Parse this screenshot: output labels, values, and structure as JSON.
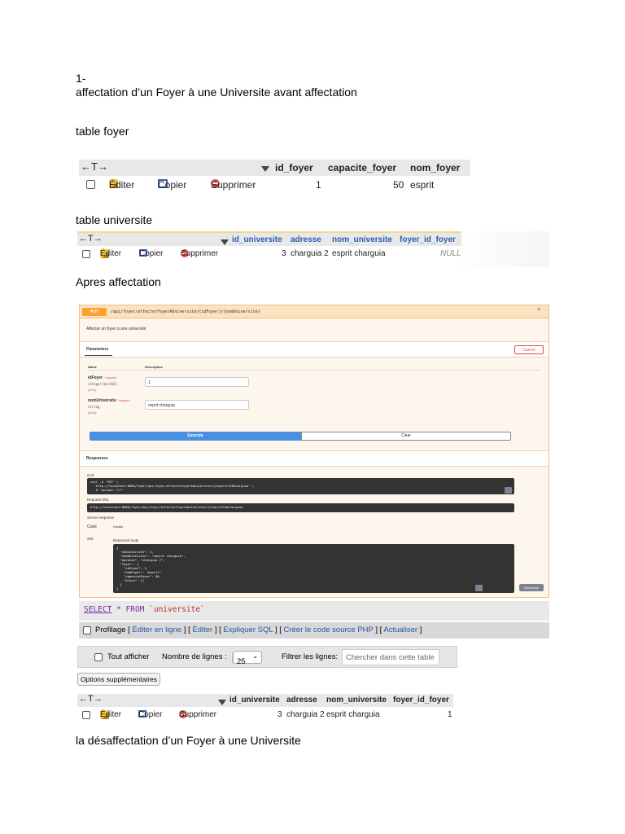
{
  "doc": {
    "step_number": "1-",
    "heading": "affectation d’un Foyer à une Universite avant affectation",
    "table_foyer_label": "table foyer",
    "table_universite_label": "table universite",
    "apres_label": "Apres affectation",
    "footer_heading": "la désaffectation d’un Foyer à une Universite"
  },
  "actions": {
    "arrows": "←T→",
    "edit": "Éditer",
    "copy": "Copier",
    "delete": "Supprimer"
  },
  "foyer_table": {
    "columns": [
      "id_foyer",
      "capacite_foyer",
      "nom_foyer"
    ],
    "row": {
      "id_foyer": "1",
      "capacite_foyer": "50",
      "nom_foyer": "esprit"
    }
  },
  "universite_table_before": {
    "columns": [
      "id_universite",
      "adresse",
      "nom_universite",
      "foyer_id_foyer"
    ],
    "row": {
      "id_universite": "3",
      "adresse": "charguia 2",
      "nom_universite": "esprit charguia",
      "foyer_id_foyer": "NULL"
    }
  },
  "swagger": {
    "method": "PUT",
    "path": "/api/foyer/affecterFoyerAUniversite/{idFoyer}/{nomUniversite}",
    "description": "Affecter un foyer à une université",
    "parameters_tab": "Parameters",
    "cancel": "Cancel",
    "col_name": "Name",
    "col_description": "Description",
    "required": "* required",
    "p1_name": "idFoyer",
    "p1_type": "integer($int64)",
    "p1_in": "(path)",
    "p1_value": "1",
    "p2_name": "nomUniversite",
    "p2_type": "string",
    "p2_in": "(path)",
    "p2_value": "esprit charguia",
    "execute": "Execute",
    "clear": "Clear",
    "responses": "Responses",
    "curl_label": "Curl",
    "curl": "curl -X 'PUT' \\\n  'http://localhost:8080/foyer/api/foyer/affecterFoyerAUniversite/1/esprit%20charguia' \\\n  -H 'accept: */*'",
    "request_url_label": "Request URL",
    "request_url": "http://localhost:8080/foyer/api/foyer/affecterFoyerAUniversite/1/esprit%20charguia",
    "server_response_label": "Server response",
    "code_label": "Code",
    "details_label": "Details",
    "code": "200",
    "response_body_label": "Response body",
    "response_body": "{\n  \"idUniversite\": 3,\n  \"nomUniversite\": \"esprit charguia\",\n  \"adresse\": \"charguia 2\",\n  \"foyer\": {\n    \"idFoyer\": 1,\n    \"nomFoyer\": \"esprit\",\n    \"capaciteFoyer\": 50,\n    \"blocs\": []\n  }\n}",
    "download": "Download"
  },
  "sql": {
    "select": "SELECT",
    "star_from": "* FROM",
    "table": "`universite`"
  },
  "profiling": {
    "label": "Profilage",
    "links": [
      "Éditer en ligne",
      "Éditer",
      "Expliquer SQL",
      "Créer le code source PHP",
      "Actualiser"
    ]
  },
  "filters": {
    "show_all": "Tout afficher",
    "rows_label": "Nombre de lignes :",
    "rows_value": "25",
    "filter_label": "Filtrer les lignes:",
    "search_placeholder": "Chercher dans cette table"
  },
  "options_button": "Options supplémentaires",
  "universite_table_after": {
    "columns": [
      "id_universite",
      "adresse",
      "nom_universite",
      "foyer_id_foyer"
    ],
    "row": {
      "id_universite": "3",
      "adresse": "charguia 2",
      "nom_universite": "esprit charguia",
      "foyer_id_foyer": "1"
    }
  }
}
